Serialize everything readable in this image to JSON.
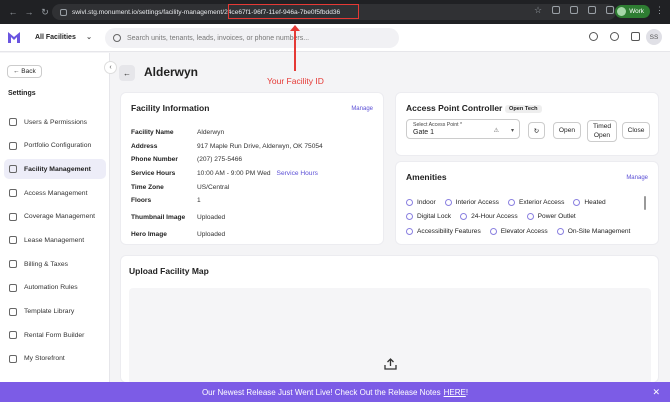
{
  "browser": {
    "url_prefix": "swivl.stg.monument.io/settings/facility-management/",
    "url_id": "24ce67f1-96f7-11ef-946a-7be0f5fbdd36",
    "profile_label": "Work"
  },
  "annotation": {
    "text": "Your Facility ID"
  },
  "header": {
    "facility_select": "All Facilities",
    "search_placeholder": "Search units, tenants, leads, invoices, or phone numbers...",
    "avatar_initials": "SS"
  },
  "sidebar": {
    "back_label": "← Back",
    "title": "Settings",
    "items": [
      {
        "label": "Users & Permissions",
        "icon": "users-icon"
      },
      {
        "label": "Portfolio Configuration",
        "icon": "globe-icon"
      },
      {
        "label": "Facility Management",
        "icon": "facility-icon",
        "active": true
      },
      {
        "label": "Access Management",
        "icon": "access-icon"
      },
      {
        "label": "Coverage Management",
        "icon": "shield-icon"
      },
      {
        "label": "Lease Management",
        "icon": "lease-icon"
      },
      {
        "label": "Billing & Taxes",
        "icon": "billing-icon"
      },
      {
        "label": "Automation Rules",
        "icon": "automation-icon"
      },
      {
        "label": "Template Library",
        "icon": "template-icon"
      },
      {
        "label": "Rental Form Builder",
        "icon": "form-builder-icon"
      },
      {
        "label": "My Storefront",
        "icon": "storefront-icon"
      }
    ]
  },
  "page": {
    "title": "Alderwyn"
  },
  "facility_info": {
    "title": "Facility Information",
    "manage": "Manage",
    "rows": [
      {
        "label": "Facility Name",
        "value": "Alderwyn"
      },
      {
        "label": "Address",
        "value": "917 Maple Run Drive, Alderwyn, OK 75054"
      },
      {
        "label": "Phone Number",
        "value": "(207) 275-5466"
      },
      {
        "label": "Service Hours",
        "value": "10:00 AM - 9:00 PM  Wed",
        "link": "Service Hours"
      },
      {
        "label": "Time Zone",
        "value": "US/Central"
      },
      {
        "label": "Floors",
        "value": "1"
      },
      {
        "label": "Thumbnail Image",
        "value": "Uploaded"
      },
      {
        "label": "Hero Image",
        "value": "Uploaded"
      }
    ]
  },
  "access_point": {
    "title": "Access Point Controller",
    "badge": "Open Tech",
    "select_label": "Select Access Point *",
    "select_value": "Gate 1",
    "open": "Open",
    "timed_open": "Timed Open",
    "close": "Close"
  },
  "amenities": {
    "title": "Amenities",
    "manage": "Manage",
    "rows": [
      [
        "Indoor",
        "Interior Access",
        "Exterior Access",
        "Heated"
      ],
      [
        "Digital Lock",
        "24-Hour Access",
        "Power Outlet"
      ],
      [
        "Accessibility Features",
        "Elevator Access",
        "On-Site Management"
      ]
    ]
  },
  "map": {
    "title": "Upload Facility Map"
  },
  "banner": {
    "text": "Our Newest Release Just Went Live! Check Out the Release Notes",
    "link": "HERE",
    "suffix": "!"
  }
}
